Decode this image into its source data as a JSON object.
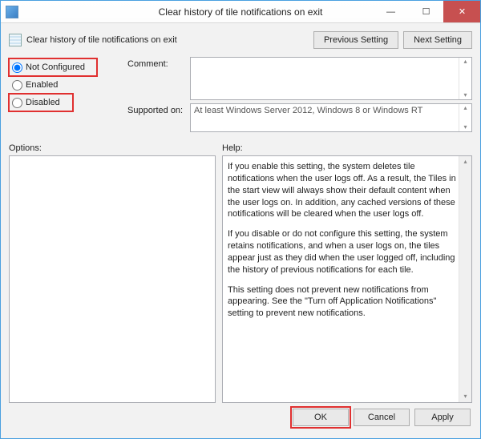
{
  "window": {
    "title": "Clear history of tile notifications on exit"
  },
  "header": {
    "policy_title": "Clear history of tile notifications on exit",
    "previous": "Previous Setting",
    "next": "Next Setting"
  },
  "radios": {
    "not_configured": "Not Configured",
    "enabled": "Enabled",
    "disabled": "Disabled",
    "selected": "not_configured"
  },
  "fields": {
    "comment_label": "Comment:",
    "comment_value": "",
    "supported_label": "Supported on:",
    "supported_value": "At least Windows Server 2012, Windows 8 or Windows RT"
  },
  "panes": {
    "options_label": "Options:",
    "help_label": "Help:",
    "help_paragraphs": [
      "If you enable this setting, the system deletes tile notifications when the user logs off. As a result, the Tiles in the start view will always show their default content when the user logs on. In addition, any cached versions of these notifications will be cleared when the user logs off.",
      "If you disable or do not configure this setting, the system retains notifications, and when a user logs on, the tiles appear just as they did when the user logged off, including the history of previous notifications for each tile.",
      "This setting does not prevent new notifications from appearing. See the \"Turn off Application Notifications\" setting to prevent new notifications."
    ]
  },
  "footer": {
    "ok": "OK",
    "cancel": "Cancel",
    "apply": "Apply"
  }
}
